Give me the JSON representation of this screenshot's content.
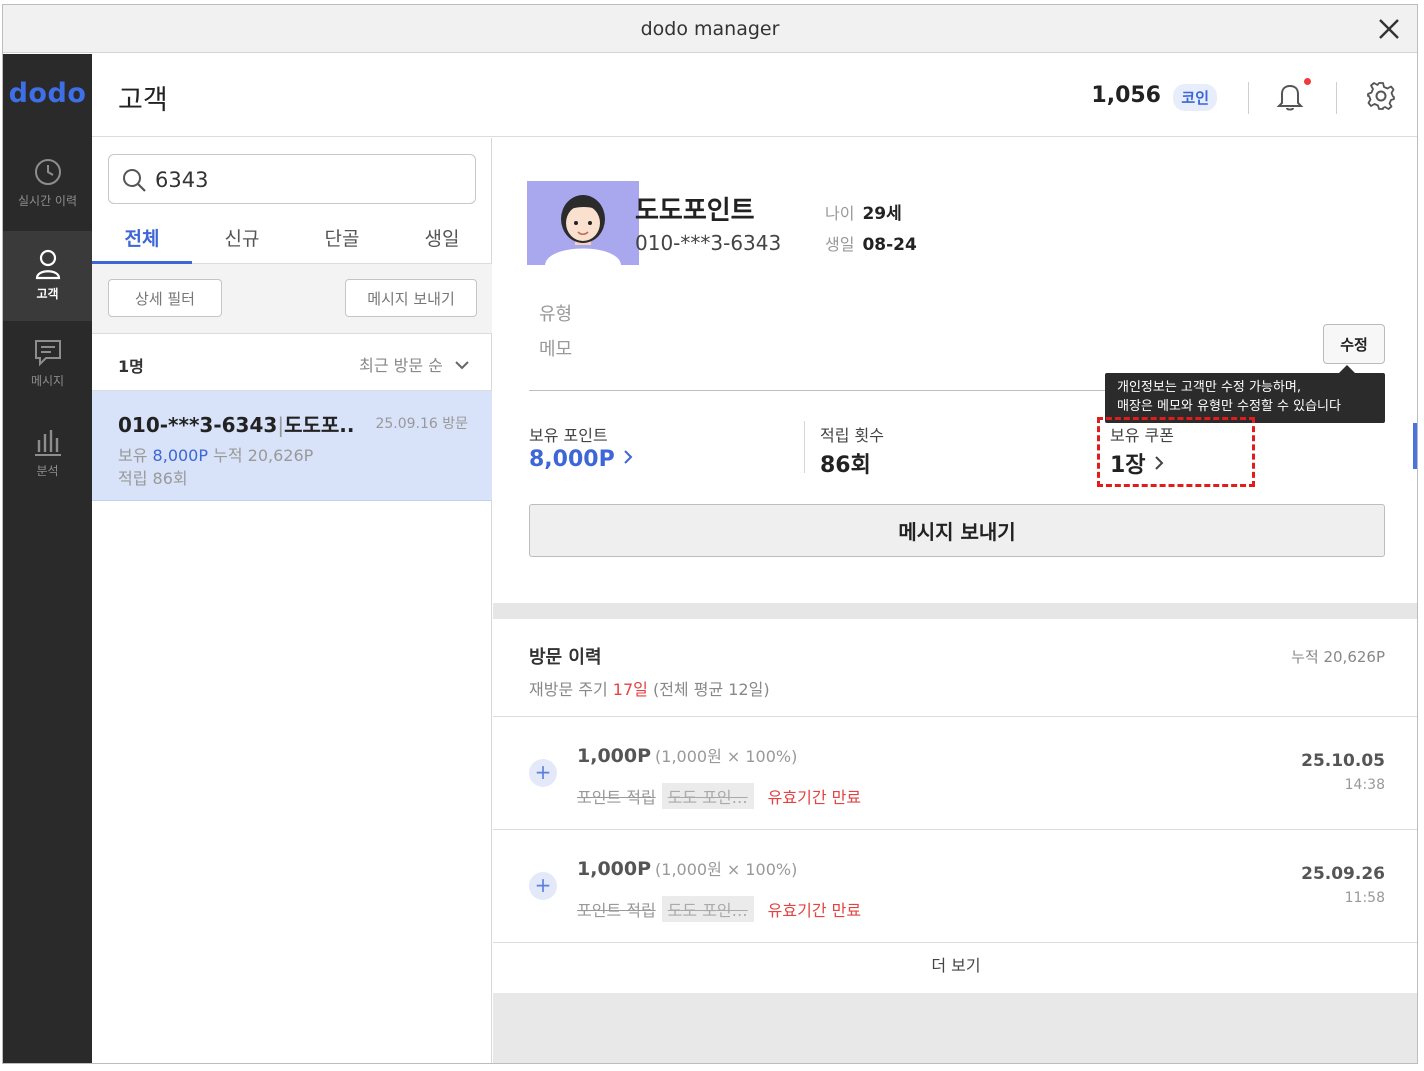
{
  "window": {
    "title": "dodo manager"
  },
  "sidebar": {
    "logo": "dodo",
    "items": [
      {
        "label": "실시간 이력",
        "icon": "clock-icon",
        "active": false
      },
      {
        "label": "고객",
        "icon": "user-icon",
        "active": true
      },
      {
        "label": "메시지",
        "icon": "message-icon",
        "active": false
      },
      {
        "label": "분석",
        "icon": "bar-chart-icon",
        "active": false
      }
    ]
  },
  "header": {
    "title": "고객",
    "coins": "1,056",
    "coin_label": "코인"
  },
  "customer_list": {
    "search_value": "6343",
    "tabs": [
      "전체",
      "신규",
      "단골",
      "생일"
    ],
    "active_tab": "전체",
    "detail_filter": "상세 필터",
    "send_message": "메시지 보내기",
    "count": "1명",
    "sort": "최근 방문 순",
    "rows": [
      {
        "phone": "010-***3-6343",
        "name": "도도포..",
        "date": "25.09.16 방문",
        "hold_label": "보유",
        "hold_points": "8,000P",
        "total_label": "누적",
        "total_points": "20,626P",
        "earn_count": "적립 86회"
      }
    ]
  },
  "customer_detail": {
    "name": "도도포인트",
    "phone": "010-***3-6343",
    "age_label": "나이",
    "age": "29세",
    "birthday_label": "생일",
    "birthday": "08-24",
    "type_label": "유형",
    "memo_label": "메모",
    "edit_button": "수정",
    "tooltip_line1": "개인정보는 고객만 수정 가능하며,",
    "tooltip_line2": "매장은 메모와 유형만 수정할 수 있습니다",
    "stats": {
      "points_label": "보유 포인트",
      "points": "8,000P",
      "visits_label": "적립 횟수",
      "visits": "86회",
      "coupons_label": "보유 쿠폰",
      "coupons": "1장"
    },
    "send_message_button": "메시지 보내기"
  },
  "visit_history": {
    "title": "방문 이력",
    "total": "누적 20,626P",
    "cycle_prefix": "재방문 주기 ",
    "cycle_days": "17일",
    "cycle_suffix": " (전체 평균 12일)",
    "entries": [
      {
        "amount": "1,000P",
        "calc": "(1,000원 × 100%)",
        "type": "포인트 적립",
        "tag": "도도 포인…",
        "status": "유효기간 만료",
        "date": "25.10.05",
        "time": "14:38"
      },
      {
        "amount": "1,000P",
        "calc": "(1,000원 × 100%)",
        "type": "포인트 적립",
        "tag": "도도 포인…",
        "status": "유효기간 만료",
        "date": "25.09.26",
        "time": "11:58"
      }
    ],
    "more": "더 보기"
  },
  "colors": {
    "accent": "#3d66d6",
    "sidebar_bg": "#2a2a2a",
    "highlight_row": "#d8e2f8",
    "alert": "#e21b1b"
  }
}
